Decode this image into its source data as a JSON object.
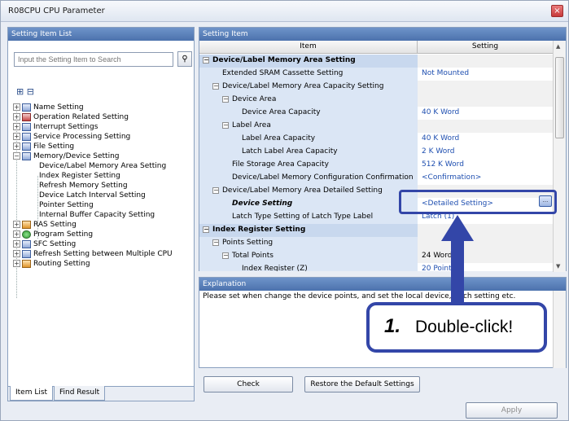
{
  "window": {
    "title": "R08CPU CPU Parameter",
    "close_glyph": "×"
  },
  "left_panel": {
    "header": "Setting Item List",
    "search_placeholder": "Input the Setting Item to Search",
    "search_icon": "binoculars-icon",
    "tree": [
      {
        "label": "Name Setting",
        "expander": "+"
      },
      {
        "label": "Operation Related Setting",
        "expander": "+"
      },
      {
        "label": "Interrupt Settings",
        "expander": "+"
      },
      {
        "label": "Service Processing Setting",
        "expander": "+"
      },
      {
        "label": "File Setting",
        "expander": "+"
      },
      {
        "label": "Memory/Device Setting",
        "expander": "−"
      },
      {
        "label": "Device/Label Memory Area Setting"
      },
      {
        "label": "Index Register Setting"
      },
      {
        "label": "Refresh Memory Setting"
      },
      {
        "label": "Device Latch Interval Setting"
      },
      {
        "label": "Pointer Setting"
      },
      {
        "label": "Internal Buffer Capacity Setting"
      },
      {
        "label": "RAS Setting",
        "expander": "+"
      },
      {
        "label": "Program Setting",
        "expander": "+"
      },
      {
        "label": "SFC Setting",
        "expander": "+"
      },
      {
        "label": "Refresh Setting between Multiple CPU",
        "expander": "+"
      },
      {
        "label": "Routing Setting",
        "expander": "+"
      }
    ],
    "tabs": [
      "Item List",
      "Find Result"
    ]
  },
  "right_panel": {
    "header": "Setting Item",
    "col_item": "Item",
    "col_setting": "Setting",
    "rows": [
      {
        "item": "Device/Label Memory Area Setting",
        "setting": ""
      },
      {
        "item": "Extended SRAM Cassette Setting",
        "setting": "Not Mounted"
      },
      {
        "item": "Device/Label Memory Area Capacity Setting",
        "setting": ""
      },
      {
        "item": "Device Area",
        "setting": ""
      },
      {
        "item": "Device Area Capacity",
        "setting": "40 K Word"
      },
      {
        "item": "Label Area",
        "setting": ""
      },
      {
        "item": "Label Area Capacity",
        "setting": "40 K Word"
      },
      {
        "item": "Latch Label Area Capacity",
        "setting": "2 K Word"
      },
      {
        "item": "File Storage Area Capacity",
        "setting": "512 K Word"
      },
      {
        "item": "Device/Label Memory Configuration Confirmation",
        "setting": "<Confirmation>"
      },
      {
        "item": "Device/Label Memory Area Detailed Setting",
        "setting": ""
      },
      {
        "item": "Device Setting",
        "setting": "<Detailed Setting>"
      },
      {
        "item": "Latch Type Setting of Latch Type Label",
        "setting": "Latch (1)"
      },
      {
        "item": "Index Register Setting",
        "setting": ""
      },
      {
        "item": "Points Setting",
        "setting": ""
      },
      {
        "item": "Total Points",
        "setting": "24 Word"
      },
      {
        "item": "Index Register (Z)",
        "setting": "20 Points"
      }
    ]
  },
  "explanation": {
    "header": "Explanation",
    "text": "Please set when change the device points, and set the local device, latch setting etc."
  },
  "buttons": {
    "check": "Check",
    "restore": "Restore the Default Settings",
    "apply": "Apply"
  },
  "callout": {
    "number": "1.",
    "label": "Double-click!"
  },
  "colors": {
    "accent": "#3346a8",
    "link_blue": "#1f4fb0",
    "panel_header": "#4c72ad"
  }
}
